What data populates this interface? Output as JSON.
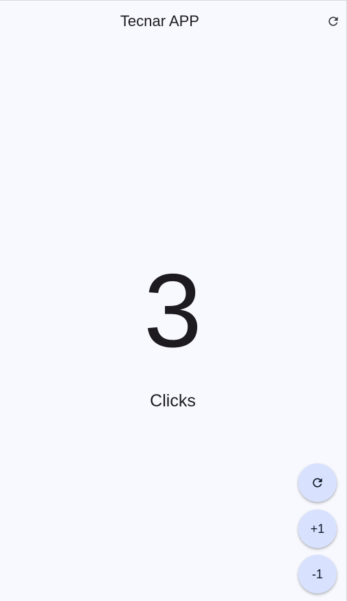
{
  "app_bar": {
    "title": "Tecnar APP",
    "action_icon": "refresh-icon"
  },
  "counter": {
    "value": "3",
    "label": "Clicks"
  },
  "floating_actions": {
    "reset_icon": "refresh-icon",
    "increment_label": "+1",
    "decrement_label": "-1",
    "background_color": "#d8e2ff"
  },
  "theme": {
    "surface_color": "#f8f9fe",
    "text_color": "#1d1b20"
  }
}
